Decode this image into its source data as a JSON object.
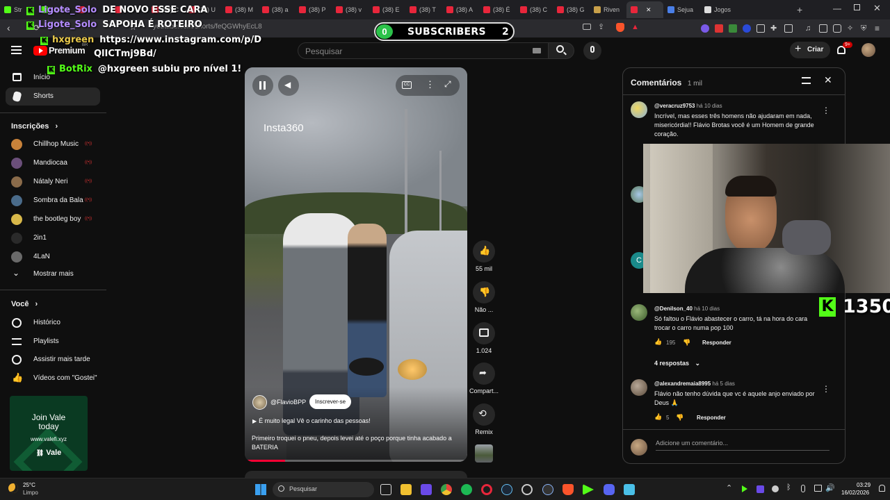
{
  "browser": {
    "tabs": [
      {
        "label": "Str",
        "icon_color": "#53fc18"
      },
      {
        "label": "Ligote",
        "icon_color": "#53fc18"
      },
      {
        "label": "",
        "icon_color": "#e8263b"
      },
      {
        "label": "",
        "icon_color": "#e8263b"
      },
      {
        "label": "(38) C",
        "icon_color": "#e8263b"
      },
      {
        "label": "(38) U",
        "icon_color": "#e8263b"
      },
      {
        "label": "(38) M",
        "icon_color": "#e8263b"
      },
      {
        "label": "(38) a",
        "icon_color": "#e8263b"
      },
      {
        "label": "(38) P",
        "icon_color": "#e8263b"
      },
      {
        "label": "(38) v",
        "icon_color": "#e8263b"
      },
      {
        "label": "(38) E",
        "icon_color": "#e8263b"
      },
      {
        "label": "(38) T",
        "icon_color": "#e8263b"
      },
      {
        "label": "(38) A",
        "icon_color": "#e8263b"
      },
      {
        "label": "(38) É",
        "icon_color": "#e8263b"
      },
      {
        "label": "(38) C",
        "icon_color": "#e8263b"
      },
      {
        "label": "(38) G",
        "icon_color": "#e8263b"
      },
      {
        "label": "Riven",
        "icon_color": "#c8a04a"
      },
      {
        "label": "",
        "icon_color": "#e8263b",
        "active": true
      },
      {
        "label": "Sejua",
        "icon_color": "#4a7fe8"
      },
      {
        "label": "Jogos",
        "icon_color": "#dddddd"
      }
    ],
    "url": "youtube.com/shorts/feQGWhyEcL8"
  },
  "youtube": {
    "brand": "Premium",
    "brand_region": "BR",
    "search_placeholder": "Pesquisar",
    "create_label": "Criar",
    "notifications_badge": "9+"
  },
  "sidebar": {
    "items_top": [
      {
        "label": "Início",
        "icon": "home-icon"
      },
      {
        "label": "Shorts",
        "icon": "shorts-icon"
      }
    ],
    "subscriptions_title": "Inscrições",
    "subscriptions": [
      {
        "label": "Chillhop Music",
        "color": "#c8823a"
      },
      {
        "label": "Mandiocaa",
        "color": "#6b4f7a"
      },
      {
        "label": "Nátaly Neri",
        "color": "#8a6b4a"
      },
      {
        "label": "Sombra da Bala",
        "color": "#4a6b8a"
      },
      {
        "label": "the bootleg boy",
        "color": "#d8b84a"
      },
      {
        "label": "2in1",
        "color": "#2a2a2a"
      },
      {
        "label": "4LaN",
        "color": "#6a6a6a"
      }
    ],
    "show_more": "Mostrar mais",
    "you_title": "Você",
    "you_items": [
      {
        "label": "Histórico",
        "icon": "history-icon"
      },
      {
        "label": "Playlists",
        "icon": "playlists-icon"
      },
      {
        "label": "Assistir mais tarde",
        "icon": "watch-later-icon"
      },
      {
        "label": "Vídeos com \"Gostei\"",
        "icon": "like-icon"
      }
    ]
  },
  "overlay": {
    "chat": [
      {
        "user": "Ligote_Solo",
        "user_color": "#b48cff",
        "text": "DE NOVO ESSE CARA"
      },
      {
        "user": "Ligote_Solo",
        "user_color": "#b48cff",
        "text": "SAPOHA É ROTEIRO"
      },
      {
        "user": "hxgreen",
        "user_color": "#e8c84a",
        "text": "https://www.instagram.com/p/D"
      },
      {
        "user": "",
        "user_color": "#ffffff",
        "text": "QlICTmj9Bd/"
      },
      {
        "user": "BotRix",
        "user_color": "#53fc18",
        "text": "@hxgreen subiu pro nível 1!"
      }
    ],
    "subscribers_label": "SUBSCRIBERS",
    "subscribers_left": "0",
    "subscribers_right": "2",
    "kick_count": "1350"
  },
  "video": {
    "watermark": "Insta360",
    "channel": "@FlavioBPP",
    "subscribe_label": "Inscrever-se",
    "music_line": "É muito legal Vê o carinho das pessoas!",
    "description": "Primeiro troquei o pneu, depois levei até o poço porque tinha acabado a BATERIA"
  },
  "actions": {
    "likes": "55 mil",
    "dislike": "Não ...",
    "comments": "1.024",
    "share": "Compart...",
    "remix": "Remix"
  },
  "comments": {
    "title": "Comentários",
    "count": "1 mil",
    "list": [
      {
        "user": "@veracruz9753",
        "time": "há 10 dias",
        "text": "Incrível, mas esses três homens não ajudaram em nada, misericórdia!! Flávio Brotas você é um Homem de grande coração.",
        "likes": "",
        "avatar": "#e8c84a"
      },
      {
        "user": "@Denilson_40",
        "time": "há 10 dias",
        "text": "Só faltou o Flávio abastecer o carro, tá na hora do cara trocar o carro numa pop 100",
        "likes": "195",
        "avatar": "#4a7a3a"
      },
      {
        "user": "@alexandremaia8995",
        "time": "há 5 dias",
        "text": "Flávio não tenho dúvida que vc é aquele anjo enviado por Deus 🙏",
        "likes": "5",
        "avatar": "#8a7a6a"
      }
    ],
    "replies_label": "4 respostas",
    "reply_label": "Responder",
    "add_placeholder": "Adicione um comentário...",
    "partial_avatar_letter": "C"
  },
  "ad": {
    "line1": "Join Vale",
    "line2": "today",
    "site": "www.valefi.xyz",
    "brand": "Vale"
  },
  "taskbar": {
    "weather_temp": "25°C",
    "weather_desc": "Limpo",
    "search_label": "Pesquisar",
    "time": "03:29",
    "date": "16/02/2026"
  }
}
